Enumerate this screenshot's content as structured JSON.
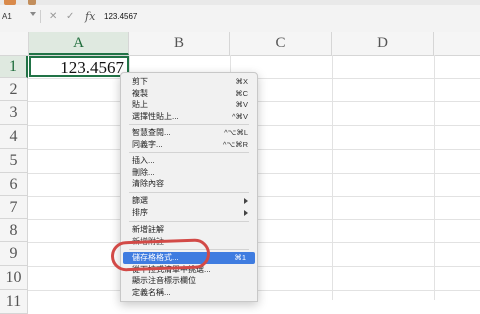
{
  "formula_bar": {
    "name_box": "A1",
    "cancel_symbol": "✕",
    "enter_symbol": "✓",
    "fx_label": "fx",
    "value": "123.4567"
  },
  "grid": {
    "columns": [
      "A",
      "B",
      "C",
      "D"
    ],
    "rows": [
      "1",
      "2",
      "3",
      "4",
      "5",
      "6",
      "7",
      "8",
      "9",
      "10",
      "11"
    ],
    "selected_cell": "A1",
    "cell_a1_value": "123.4567"
  },
  "context_menu": {
    "items": [
      {
        "label": "剪下",
        "shortcut": "⌘X"
      },
      {
        "label": "複製",
        "shortcut": "⌘C"
      },
      {
        "label": "貼上",
        "shortcut": "⌘V"
      },
      {
        "label": "選擇性貼上...",
        "shortcut": "^⌘V"
      },
      {
        "label": "智慧查閱...",
        "shortcut": "^⌥⌘L"
      },
      {
        "label": "同義字...",
        "shortcut": "^⌥⌘R"
      },
      {
        "label": "插入..."
      },
      {
        "label": "刪除..."
      },
      {
        "label": "清除內容"
      },
      {
        "label": "篩選"
      },
      {
        "label": "排序"
      },
      {
        "label": "新增註解"
      },
      {
        "label": "新增附註"
      },
      {
        "label": "儲存格格式...",
        "shortcut": "⌘1"
      },
      {
        "label": "從下拉式清單中挑選..."
      },
      {
        "label": "顯示注音標示欄位"
      },
      {
        "label": "定義名稱..."
      }
    ],
    "highlighted_item": "儲存格格式...",
    "highlight_color": "#3f7ce0"
  },
  "annotation": {
    "type": "hand-drawn circle",
    "color": "#d24a47",
    "target": "儲存格格式..."
  },
  "colors": {
    "selection_green": "#217346"
  }
}
